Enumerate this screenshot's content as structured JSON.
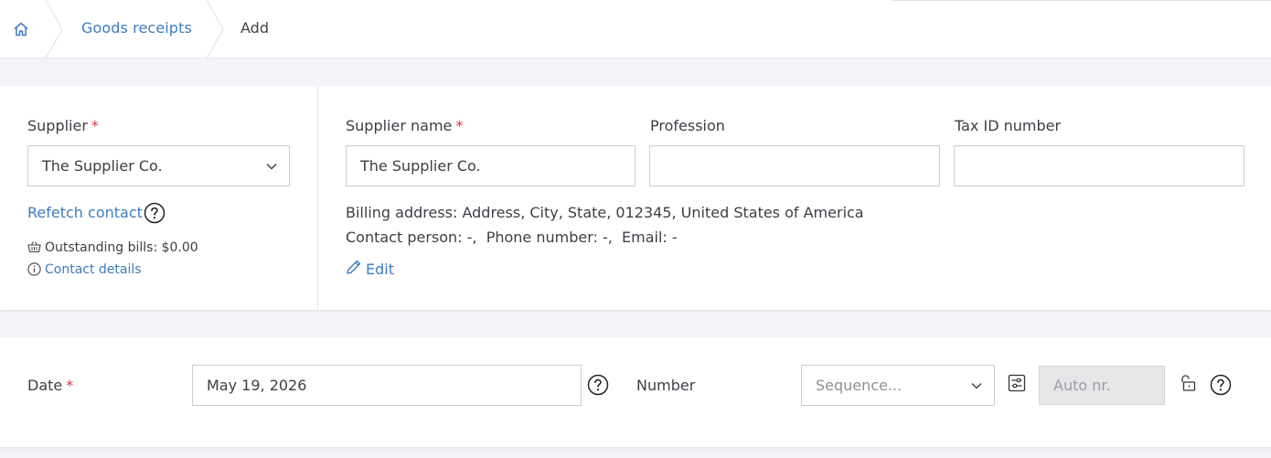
{
  "breadcrumb": {
    "items": [
      {
        "label": "Goods receipts"
      },
      {
        "label": "Add"
      }
    ]
  },
  "supplier": {
    "label": "Supplier",
    "required_mark": "*",
    "selected": "The Supplier Co.",
    "refetch_label": "Refetch contact",
    "outstanding_bills": "Outstanding bills: $0.00",
    "contact_details_label": "Contact details"
  },
  "supplier_details": {
    "name_label": "Supplier name",
    "name_required_mark": "*",
    "name_value": "The Supplier Co.",
    "profession_label": "Profession",
    "profession_value": "",
    "tax_id_label": "Tax ID number",
    "tax_id_value": "",
    "billing_address": "Billing address: Address, City, State, 012345, United States of America",
    "contact_info": "Contact person: -,  Phone number: -,  Email: -",
    "edit_label": "Edit"
  },
  "document": {
    "date_label": "Date",
    "date_required_mark": "*",
    "date_value": "May 19, 2026",
    "number_label": "Number",
    "sequence_placeholder": "Sequence...",
    "auto_number_placeholder": "Auto nr."
  },
  "colors": {
    "link": "#3e7cbf",
    "required": "#d9363e",
    "background": "#f3f4f7",
    "panel": "#ffffff",
    "disabled_field": "#e6e7e9"
  },
  "icons": {
    "home": "home-icon",
    "help": "help-circle-icon",
    "basket": "basket-icon",
    "info": "info-circle-icon",
    "pencil": "pencil-icon",
    "settings": "sliders-icon",
    "unlock": "unlock-icon",
    "caret": "chevron-down-icon"
  }
}
